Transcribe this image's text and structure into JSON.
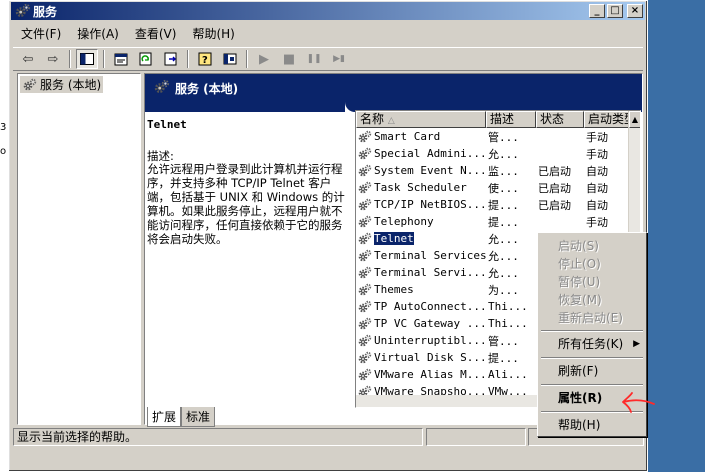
{
  "window": {
    "title": "服务",
    "min_glyph": "_",
    "max_glyph": "□",
    "close_glyph": "×"
  },
  "menu": [
    {
      "label": "文件(F)"
    },
    {
      "label": "操作(A)"
    },
    {
      "label": "查看(V)"
    },
    {
      "label": "帮助(H)"
    }
  ],
  "toolbar": {
    "buttons": [
      "back-icon",
      "forward-icon",
      "show-tree-icon",
      "properties-icon",
      "refresh-icon",
      "export-icon",
      "help-icon",
      "console-icon",
      "start-icon",
      "stop-icon",
      "pause-icon",
      "restart-icon"
    ],
    "glyphs": {
      "back": "⇦",
      "forward": "⇨",
      "start": "▶",
      "stop": "■",
      "pause": "❚❚",
      "restart": "▶▮"
    }
  },
  "tree": {
    "node": "服务 (本地)"
  },
  "pane": {
    "header": "服务 (本地)",
    "selected_name": "Telnet",
    "desc_label": "描述:",
    "desc_text": "允许远程用户登录到此计算机并运行程序，并支持多种 TCP/IP Telnet 客户端，包括基于 UNIX 和 Windows 的计算机。如果此服务停止，远程用户就不能访问程序，任何直接依赖于它的服务将会启动失败。"
  },
  "list": {
    "columns": [
      "名称",
      "描述",
      "状态",
      "启动类型"
    ],
    "sort_glyph": "△",
    "rows": [
      {
        "name": "Smart Card",
        "desc": "管...",
        "status": "",
        "start": "手动"
      },
      {
        "name": "Special Admini...",
        "desc": "允...",
        "status": "",
        "start": "手动"
      },
      {
        "name": "System Event N...",
        "desc": "监...",
        "status": "已启动",
        "start": "自动"
      },
      {
        "name": "Task Scheduler",
        "desc": "使...",
        "status": "已启动",
        "start": "自动"
      },
      {
        "name": "TCP/IP NetBIOS...",
        "desc": "提...",
        "status": "已启动",
        "start": "自动"
      },
      {
        "name": "Telephony",
        "desc": "提...",
        "status": "",
        "start": "手动"
      },
      {
        "name": "Telnet",
        "desc": "允...",
        "status": "",
        "start": ""
      },
      {
        "name": "Terminal Services",
        "desc": "允...",
        "status": "",
        "start": ""
      },
      {
        "name": "Terminal Servi...",
        "desc": "允...",
        "status": "",
        "start": ""
      },
      {
        "name": "Themes",
        "desc": "为...",
        "status": "",
        "start": ""
      },
      {
        "name": "TP AutoConnect...",
        "desc": "Thi...",
        "status": "",
        "start": ""
      },
      {
        "name": "TP VC Gateway ...",
        "desc": "Thi...",
        "status": "",
        "start": ""
      },
      {
        "name": "Uninterruptibl...",
        "desc": "管...",
        "status": "",
        "start": ""
      },
      {
        "name": "Virtual Disk S...",
        "desc": "提...",
        "status": "",
        "start": ""
      },
      {
        "name": "VMware Alias M...",
        "desc": "Ali...",
        "status": "",
        "start": ""
      },
      {
        "name": "VMware Snapsho...",
        "desc": "VMw...",
        "status": "",
        "start": ""
      }
    ]
  },
  "tabs": [
    {
      "label": "扩展"
    },
    {
      "label": "标准"
    }
  ],
  "statusbar": {
    "text": "显示当前选择的帮助。"
  },
  "context_menu": {
    "items": [
      {
        "label": "启动(S)",
        "state": "disabled"
      },
      {
        "label": "停止(O)",
        "state": "disabled"
      },
      {
        "label": "暂停(U)",
        "state": "disabled"
      },
      {
        "label": "恢复(M)",
        "state": "disabled"
      },
      {
        "label": "重新启动(E)",
        "state": "disabled"
      },
      {
        "label": "所有任务(K)",
        "state": "submenu",
        "arrow": "▶"
      },
      {
        "label": "刷新(F)",
        "state": "normal"
      },
      {
        "label": "属性(R)",
        "state": "default"
      },
      {
        "label": "帮助(H)",
        "state": "normal"
      }
    ]
  },
  "colors": {
    "titlebar": "#0a246a",
    "selection": "#0a246a",
    "face": "#d4d0c8",
    "desktop": "#3a6ea5",
    "annotation": "#ff2a2a"
  }
}
